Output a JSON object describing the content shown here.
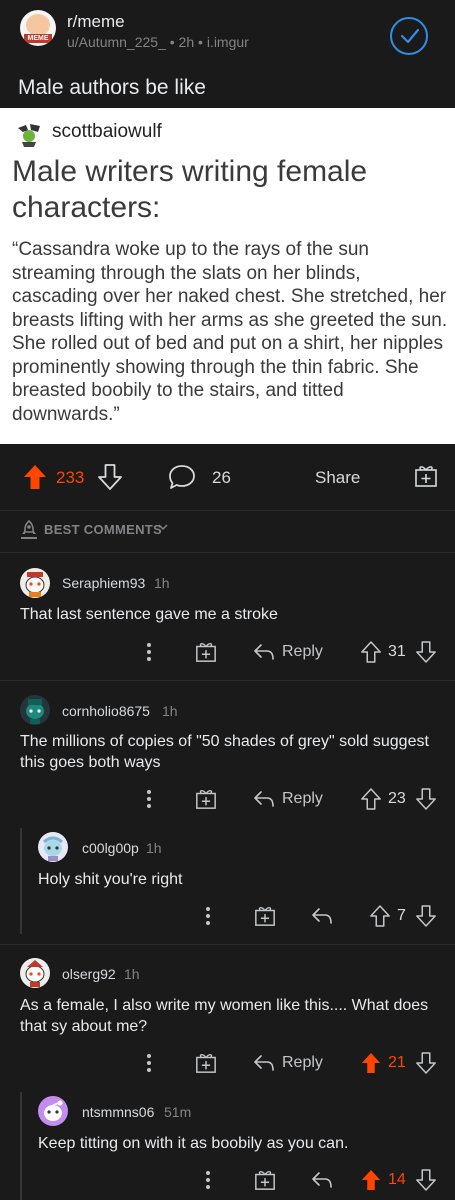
{
  "header": {
    "subreddit": "r/meme",
    "author": "u/Autumn_225_",
    "age": "2h",
    "domain": "i.imgur",
    "avatar_text": "MEME",
    "join_icon": "check-icon",
    "accent": "#2e8fe6"
  },
  "post": {
    "title": "Male authors be like",
    "image": {
      "username": "scottbaiowulf",
      "headline": "Male writers writing female characters:",
      "body": "“Cassandra woke up to the rays of the sun streaming through the slats on her blinds, cascading over her naked chest. She stretched, her breasts lifting with her arms as she greeted the sun. She rolled out of bed and put on a shirt, her nipples prominently showing through the thin fabric. She breasted boobily to the stairs, and titted downwards.”"
    },
    "score": "233",
    "comment_count": "26",
    "share_label": "Share",
    "upvote_color": "#ff4500"
  },
  "sort": {
    "label": "BEST COMMENTS"
  },
  "comments": [
    {
      "user": "Seraphiem93",
      "time": "1h",
      "text": "That last sentence gave me a stroke",
      "reply_label": "Reply",
      "score": "31"
    },
    {
      "user": "cornholio8675",
      "time": "1h",
      "text": "The millions of copies of \"50 shades of grey\" sold suggest this goes both ways",
      "reply_label": "Reply",
      "score": "23"
    },
    {
      "user": "c00lg00p",
      "time": "1h",
      "text": "Holy shit you're right",
      "score": "7"
    },
    {
      "user": "olserg92",
      "time": "1h",
      "text": "As a female, I also write my women like this.... What does that sy about me?",
      "reply_label": "Reply",
      "score": "21"
    },
    {
      "user": "ntsmmns06",
      "time": "51m",
      "text": "Keep titting on with it as boobily as you can.",
      "score": "14"
    }
  ]
}
